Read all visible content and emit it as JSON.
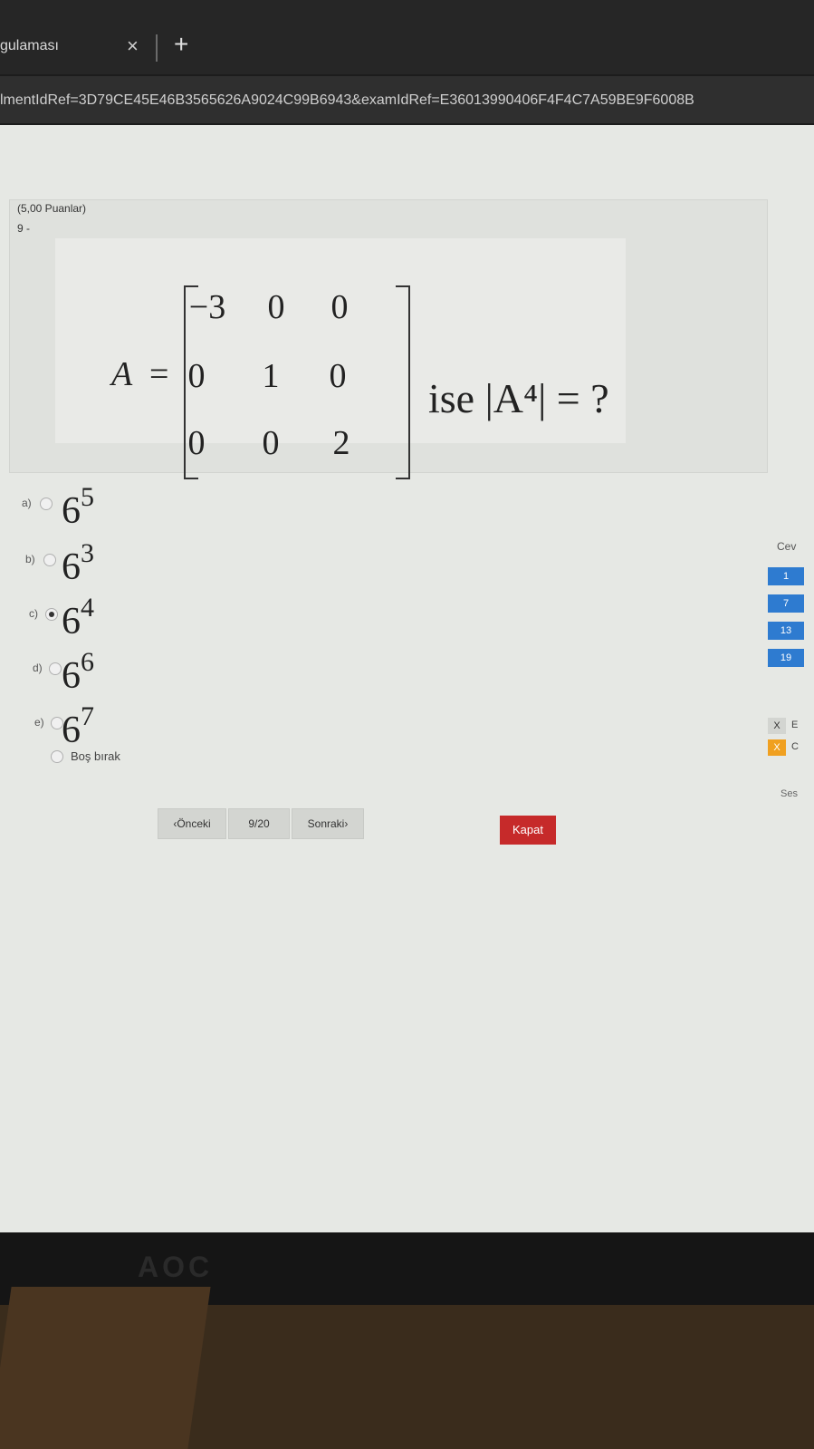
{
  "browser": {
    "tab_title": "gulaması",
    "tab_close": "×",
    "tab_new": "+",
    "url": "lmentIdRef=3D79CE45E46B3565626A9024C99B6943&examIdRef=E36013990406F4F4C7A59BE9F6008B"
  },
  "question": {
    "points": "(5,00 Puanlar)",
    "number": "9 -",
    "lhs": "A",
    "lhs_eq": "=",
    "matrix": [
      [
        "−3",
        "0",
        "0"
      ],
      [
        "0",
        "1",
        "0"
      ],
      [
        "0",
        "0",
        "2"
      ]
    ],
    "rhs": "ise |A⁴| = ?"
  },
  "options": [
    {
      "letter": "a)",
      "base": "6",
      "exp": "5",
      "selected": false
    },
    {
      "letter": "b)",
      "base": "6",
      "exp": "3",
      "selected": false
    },
    {
      "letter": "c)",
      "base": "6",
      "exp": "4",
      "selected": true
    },
    {
      "letter": "d)",
      "base": "6",
      "exp": "6",
      "selected": false
    },
    {
      "letter": "e)",
      "base": "6",
      "exp": "7",
      "selected": false
    }
  ],
  "skip_label": "Boş bırak",
  "nav": {
    "prev": "‹Önceki",
    "page": "9/20",
    "next": "Sonraki›",
    "close": "Kapat"
  },
  "sidebar": {
    "label": "Cev",
    "chips": [
      "1",
      "7",
      "13",
      "19"
    ],
    "legend": [
      {
        "mark": "X",
        "text": "E",
        "color": "#d3d5d1"
      },
      {
        "mark": "X",
        "text": "C",
        "color": "#f0a020"
      }
    ],
    "footer": "Ses"
  },
  "monitor_brand": "AOC"
}
